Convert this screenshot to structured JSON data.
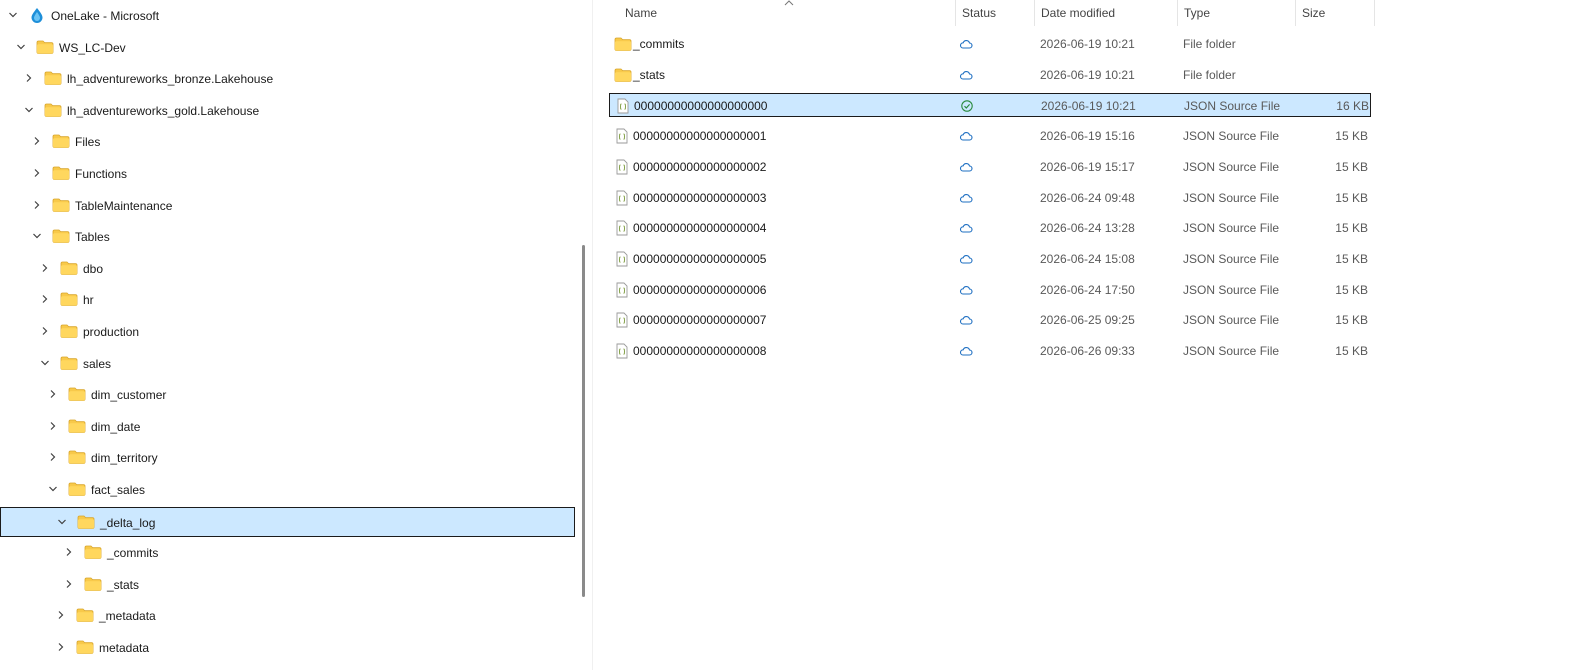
{
  "nav": {
    "items": [
      {
        "label": "OneLake - Microsoft",
        "icon": "onelake-icon",
        "depth": 0,
        "expanded": true
      },
      {
        "label": "WS_LC-Dev",
        "icon": "folder-icon",
        "depth": 1,
        "expanded": true
      },
      {
        "label": "lh_adventureworks_bronze.Lakehouse",
        "icon": "folder-icon",
        "depth": 2,
        "expanded": false
      },
      {
        "label": "lh_adventureworks_gold.Lakehouse",
        "icon": "folder-icon",
        "depth": 2,
        "expanded": true
      },
      {
        "label": "Files",
        "icon": "folder-icon",
        "depth": 3,
        "expanded": false
      },
      {
        "label": "Functions",
        "icon": "folder-icon",
        "depth": 3,
        "expanded": false
      },
      {
        "label": "TableMaintenance",
        "icon": "folder-icon",
        "depth": 3,
        "expanded": false
      },
      {
        "label": "Tables",
        "icon": "folder-icon",
        "depth": 3,
        "expanded": true
      },
      {
        "label": "dbo",
        "icon": "folder-icon",
        "depth": 4,
        "expanded": false
      },
      {
        "label": "hr",
        "icon": "folder-icon",
        "depth": 4,
        "expanded": false
      },
      {
        "label": "production",
        "icon": "folder-icon",
        "depth": 4,
        "expanded": false
      },
      {
        "label": "sales",
        "icon": "folder-icon",
        "depth": 4,
        "expanded": true
      },
      {
        "label": "dim_customer",
        "icon": "folder-icon",
        "depth": 5,
        "expanded": false
      },
      {
        "label": "dim_date",
        "icon": "folder-icon",
        "depth": 5,
        "expanded": false
      },
      {
        "label": "dim_territory",
        "icon": "folder-icon",
        "depth": 5,
        "expanded": false
      },
      {
        "label": "fact_sales",
        "icon": "folder-icon",
        "depth": 5,
        "expanded": true
      },
      {
        "label": "_delta_log",
        "icon": "folder-icon",
        "depth": 6,
        "expanded": true,
        "selected": true
      },
      {
        "label": "_commits",
        "icon": "folder-icon",
        "depth": 7,
        "expanded": false
      },
      {
        "label": "_stats",
        "icon": "folder-icon",
        "depth": 7,
        "expanded": false
      },
      {
        "label": "_metadata",
        "icon": "folder-icon",
        "depth": 6,
        "expanded": false
      },
      {
        "label": "metadata",
        "icon": "folder-icon",
        "depth": 6,
        "expanded": false
      }
    ]
  },
  "list": {
    "columns": {
      "name": "Name",
      "status": "Status",
      "date": "Date modified",
      "type": "Type",
      "size": "Size"
    },
    "rows": [
      {
        "name": "_commits",
        "kind": "folder",
        "status": "cloud",
        "date": "2026-06-19 10:21",
        "type": "File folder",
        "size": ""
      },
      {
        "name": "_stats",
        "kind": "folder",
        "status": "cloud",
        "date": "2026-06-19 10:21",
        "type": "File folder",
        "size": ""
      },
      {
        "name": "00000000000000000000",
        "kind": "file",
        "status": "synced",
        "date": "2026-06-19 10:21",
        "type": "JSON Source File",
        "size": "16 KB",
        "selected": true
      },
      {
        "name": "00000000000000000001",
        "kind": "file",
        "status": "cloud",
        "date": "2026-06-19 15:16",
        "type": "JSON Source File",
        "size": "15 KB"
      },
      {
        "name": "00000000000000000002",
        "kind": "file",
        "status": "cloud",
        "date": "2026-06-19 15:17",
        "type": "JSON Source File",
        "size": "15 KB"
      },
      {
        "name": "00000000000000000003",
        "kind": "file",
        "status": "cloud",
        "date": "2026-06-24 09:48",
        "type": "JSON Source File",
        "size": "15 KB"
      },
      {
        "name": "00000000000000000004",
        "kind": "file",
        "status": "cloud",
        "date": "2026-06-24 13:28",
        "type": "JSON Source File",
        "size": "15 KB"
      },
      {
        "name": "00000000000000000005",
        "kind": "file",
        "status": "cloud",
        "date": "2026-06-24 15:08",
        "type": "JSON Source File",
        "size": "15 KB"
      },
      {
        "name": "00000000000000000006",
        "kind": "file",
        "status": "cloud",
        "date": "2026-06-24 17:50",
        "type": "JSON Source File",
        "size": "15 KB"
      },
      {
        "name": "00000000000000000007",
        "kind": "file",
        "status": "cloud",
        "date": "2026-06-25 09:25",
        "type": "JSON Source File",
        "size": "15 KB"
      },
      {
        "name": "00000000000000000008",
        "kind": "file",
        "status": "cloud",
        "date": "2026-06-26 09:33",
        "type": "JSON Source File",
        "size": "15 KB"
      }
    ]
  },
  "colors": {
    "selection": "#cce8ff",
    "folder": "#f8c94a",
    "cloud": "#1e6fc2",
    "synced": "#2a8a3e"
  }
}
